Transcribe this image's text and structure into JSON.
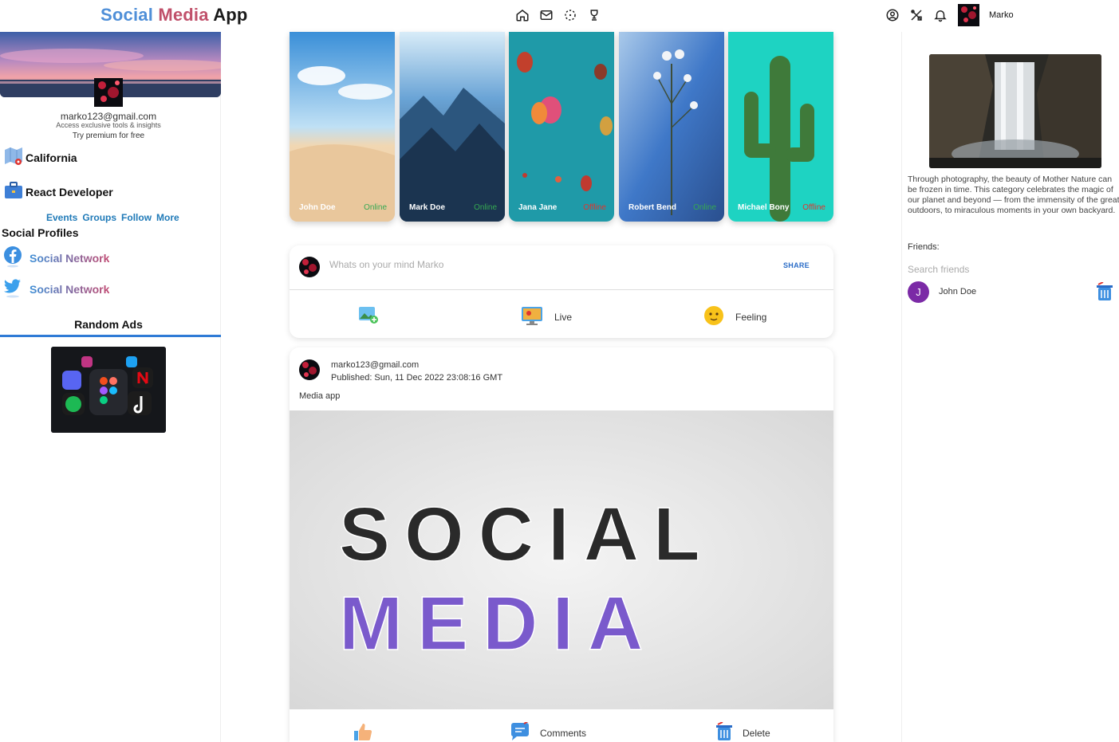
{
  "header": {
    "logo": {
      "word1": "Social",
      "word2": "Media",
      "word3": "App"
    },
    "nav_icons": [
      "home-icon",
      "mail-icon",
      "explore-icon",
      "trophy-icon"
    ],
    "right_icons": [
      "account-icon",
      "tools-icon",
      "bell-icon"
    ],
    "user_name": "Marko"
  },
  "left_sidebar": {
    "email": "marko123@gmail.com",
    "subtitle": "Access exclusive tools & insights",
    "premium": "Try premium for free",
    "location": "California",
    "job": "React Developer",
    "links": [
      "Events",
      "Groups",
      "Follow",
      "More"
    ],
    "social_title": "Social Profiles",
    "social_profiles": [
      {
        "icon": "facebook-icon",
        "label": "Social Network"
      },
      {
        "icon": "twitter-icon",
        "label": "Social Network"
      }
    ],
    "ads_title": "Random Ads"
  },
  "stories": [
    {
      "name": "John Doe",
      "status": "Online"
    },
    {
      "name": "Mark Doe",
      "status": "Online"
    },
    {
      "name": "Jana Jane",
      "status": "Offline"
    },
    {
      "name": "Robert Bend",
      "status": "Online"
    },
    {
      "name": "Michael Bony",
      "status": "Offline"
    }
  ],
  "share": {
    "placeholder": "Whats on your mind Marko",
    "button": "SHARE",
    "actions": [
      {
        "icon": "add-photo-icon",
        "label": ""
      },
      {
        "icon": "live-icon",
        "label": "Live"
      },
      {
        "icon": "emoji-icon",
        "label": "Feeling"
      }
    ]
  },
  "post": {
    "user": "marko123@gmail.com",
    "published": "Published: Sun, 11 Dec 2022 23:08:16 GMT",
    "text": "Media app",
    "image_text": {
      "line1": "SOCIAL",
      "line2": "MEDIA"
    },
    "actions": [
      {
        "icon": "like-icon",
        "label": ""
      },
      {
        "icon": "comment-icon",
        "label": "Comments"
      },
      {
        "icon": "trash-icon",
        "label": "Delete"
      }
    ]
  },
  "right_sidebar": {
    "feature_text": "Through photography, the beauty of Mother Nature can be frozen in time. This category celebrates the magic of our planet and beyond — from the immensity of the great outdoors, to miraculous moments in your own backyard.",
    "friends_title": "Friends:",
    "search_placeholder": "Search friends",
    "friends": [
      {
        "initial": "J",
        "name": "John Doe"
      }
    ]
  },
  "colors": {
    "accent": "#2f7bd6",
    "online": "#35a852",
    "offline": "#e0342f",
    "friend_avatar": "#7b2aa6"
  }
}
